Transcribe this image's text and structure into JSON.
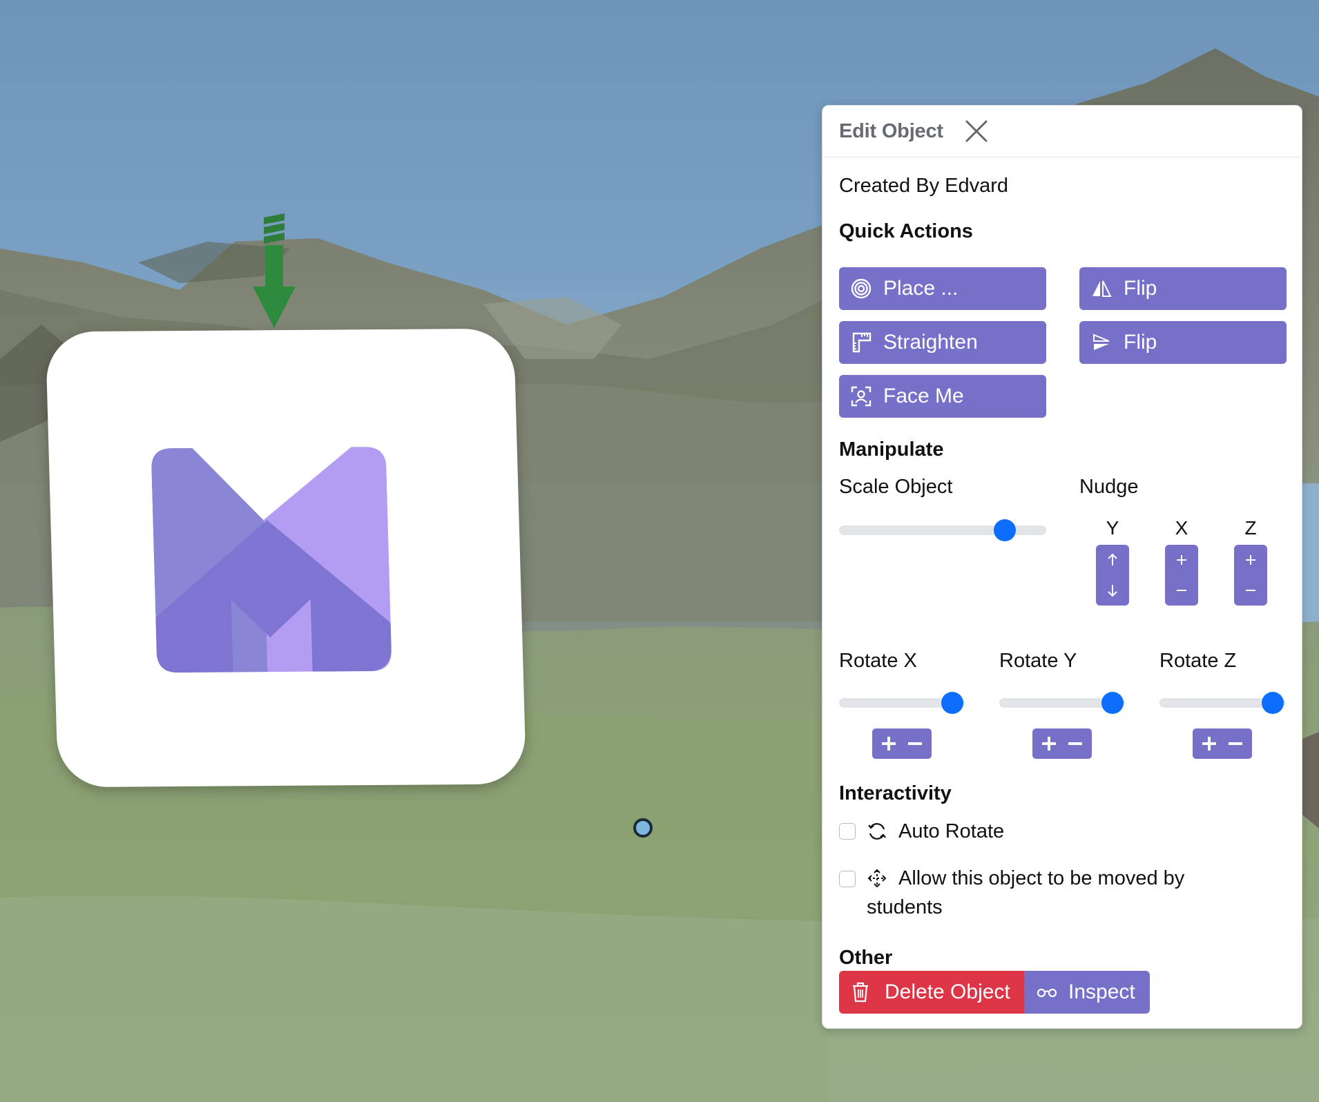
{
  "panel": {
    "title": "Edit Object",
    "created_by": "Created By Edvard",
    "sections": {
      "quick_actions": "Quick Actions",
      "manipulate": "Manipulate",
      "interactivity": "Interactivity",
      "other": "Other"
    },
    "quick_actions": {
      "place": {
        "label": "Place ...",
        "icon": "target-icon"
      },
      "flip_horizontal": {
        "label": "Flip",
        "icon": "flip-horizontal-icon"
      },
      "straighten": {
        "label": "Straighten",
        "icon": "ruler-icon"
      },
      "flip_vertical": {
        "label": "Flip",
        "icon": "flip-vertical-icon"
      },
      "face_me": {
        "label": "Face Me",
        "icon": "face-focus-icon"
      }
    },
    "manipulate": {
      "scale_label": "Scale Object",
      "scale_value": 0.8,
      "nudge_label": "Nudge",
      "nudge_axes": [
        "Y",
        "X",
        "Z"
      ],
      "rotate_x_label": "Rotate X",
      "rotate_y_label": "Rotate Y",
      "rotate_z_label": "Rotate Z",
      "rotate_x_value": 0.9,
      "rotate_y_value": 0.9,
      "rotate_z_value": 0.9
    },
    "interactivity": {
      "auto_rotate": {
        "label": "Auto Rotate",
        "checked": false,
        "icon": "refresh-icon"
      },
      "allow_move": {
        "label": "Allow this object to be moved by",
        "label_line2": "students",
        "checked": false,
        "icon": "move-arrows-icon"
      }
    },
    "other": {
      "delete_label": "Delete Object",
      "inspect_label": "Inspect"
    }
  },
  "colors": {
    "accent": "#7770c8",
    "danger": "#dc3545",
    "slider_thumb": "#0d6efd",
    "logo_light": "#b39df2",
    "logo_mid": "#8a85d4",
    "logo_dark": "#7e75d2"
  }
}
